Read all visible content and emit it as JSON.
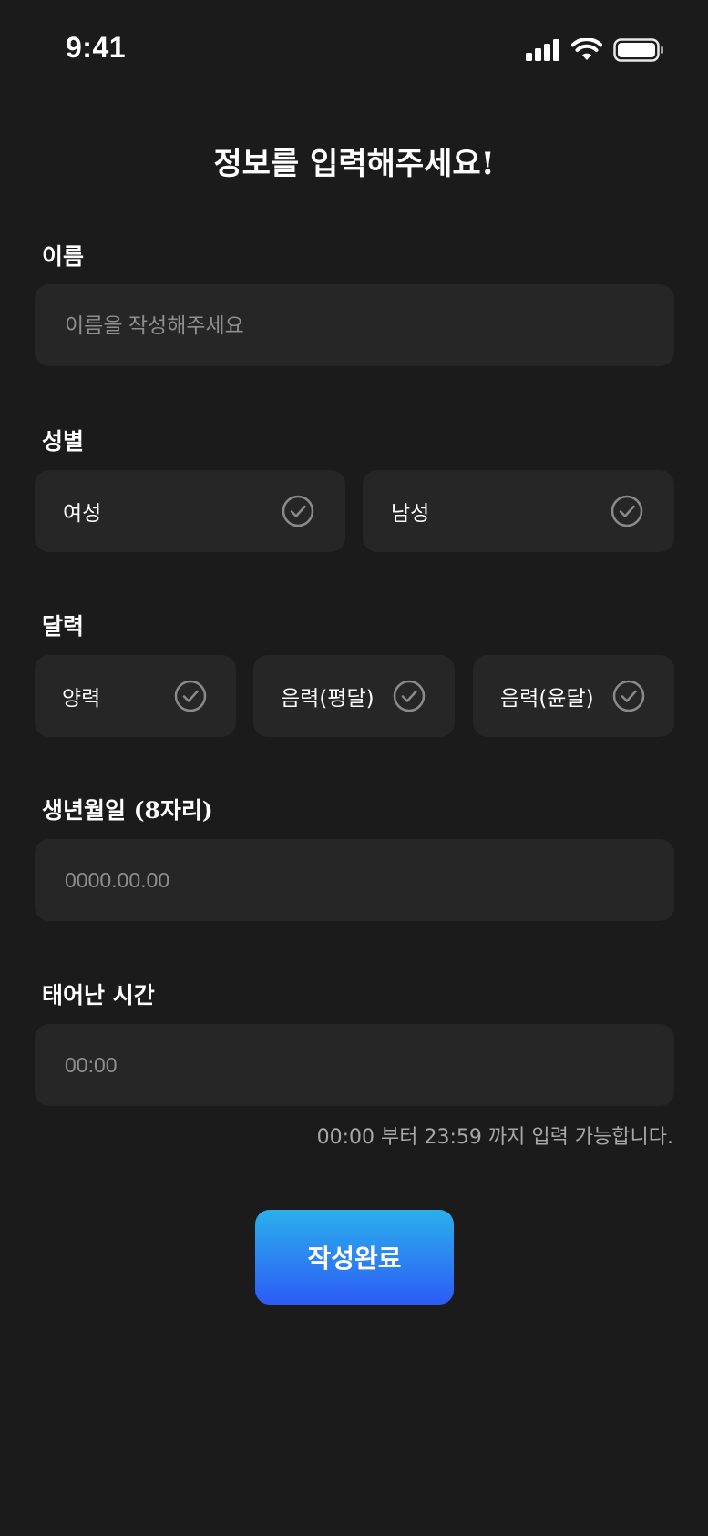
{
  "status": {
    "time": "9:41"
  },
  "title": "정보를 입력해주세요!",
  "name_section": {
    "label": "이름",
    "placeholder": "이름을 작성해주세요"
  },
  "gender_section": {
    "label": "성별",
    "options": [
      "여성",
      "남성"
    ]
  },
  "calendar_section": {
    "label": "달력",
    "options": [
      "양력",
      "음력(평달)",
      "음력(윤달)"
    ]
  },
  "birth_section": {
    "label": "생년월일 (8자리)",
    "placeholder": "0000.00.00"
  },
  "time_section": {
    "label": "태어난 시간",
    "placeholder": "00:00",
    "hint": "00:00 부터 23:59 까지 입력 가능합니다."
  },
  "submit_label": "작성완료",
  "colors": {
    "background": "#1b1b1b",
    "field": "#262626",
    "button_top": "#2bb0ec",
    "button_bottom": "#2c5bf6",
    "check": "#8a8a8a"
  }
}
